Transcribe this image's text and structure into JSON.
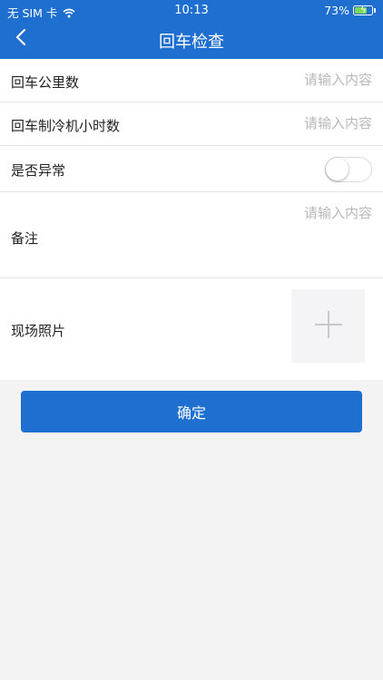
{
  "status_bar": {
    "carrier": "无 SIM 卡",
    "time": "10:13",
    "battery": "73%",
    "battery_level": 0.73
  },
  "nav": {
    "title": "回车检查",
    "back_icon": "chevron-left-icon"
  },
  "form": {
    "mileage": {
      "label": "回车公里数",
      "placeholder": "请输入内容",
      "value": ""
    },
    "cooling_hours": {
      "label": "回车制冷机小时数",
      "placeholder": "请输入内容",
      "value": ""
    },
    "abnormal": {
      "label": "是否异常",
      "on": false
    },
    "remarks": {
      "label": "备注",
      "placeholder": "请输入内容",
      "value": ""
    },
    "photos": {
      "label": "现场照片",
      "add_icon": "plus-icon"
    }
  },
  "actions": {
    "confirm_label": "确定"
  },
  "colors": {
    "primary": "#1e6fcf",
    "background": "#f3f3f3",
    "placeholder": "#b8b8b8"
  }
}
